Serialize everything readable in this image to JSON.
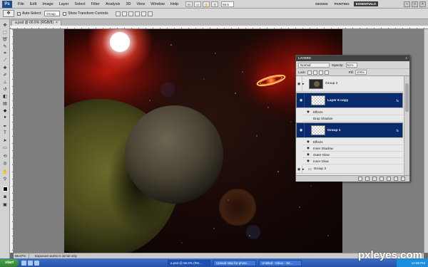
{
  "menubar": {
    "logo": "Ps",
    "items": [
      "File",
      "Edit",
      "Image",
      "Layer",
      "Select",
      "Filter",
      "Analysis",
      "3D",
      "View",
      "Window",
      "Help"
    ],
    "zoom": "66.6",
    "workspaces": [
      "DESIGN",
      "PAINTING",
      "ESSENTIALS"
    ],
    "active_workspace": "ESSENTIALS"
  },
  "options_bar": {
    "auto_select_label": "Auto-Select:",
    "auto_select_value": "Group",
    "transform_label": "Show Transform Controls"
  },
  "document": {
    "tab_title": "a.psd @ 66.6% (RGB/8)"
  },
  "layers_panel": {
    "title": "LAYERS",
    "blend_mode": "Normal",
    "opacity_label": "Opacity:",
    "opacity_value": "51%",
    "lock_label": "Lock:",
    "fill_label": "Fill:",
    "fill_value": "100%",
    "layers": [
      {
        "name": "Group 2",
        "selected": false
      },
      {
        "name": "Layer 6 copy",
        "selected": true
      },
      {
        "name": "Group 1",
        "selected": true
      },
      {
        "name": "Group 3",
        "selected": false
      }
    ],
    "effects_label": "Effects",
    "effects_layer6": [
      "Drop Shadow"
    ],
    "effects_group1": [
      "Inner Shadow",
      "Outer Glow",
      "Inner Glow"
    ]
  },
  "statusbar": {
    "zoom": "66.67%",
    "message": "Exposure works in 32-bit only"
  },
  "taskbar": {
    "start": "start",
    "tasks": [
      "a.psd @ 66.6% (RG...",
      "Upload step for photo...",
      "Untitled - Inbox - Wi..."
    ],
    "clock": "12:06 PM"
  },
  "watermark": "pxleyes.com"
}
